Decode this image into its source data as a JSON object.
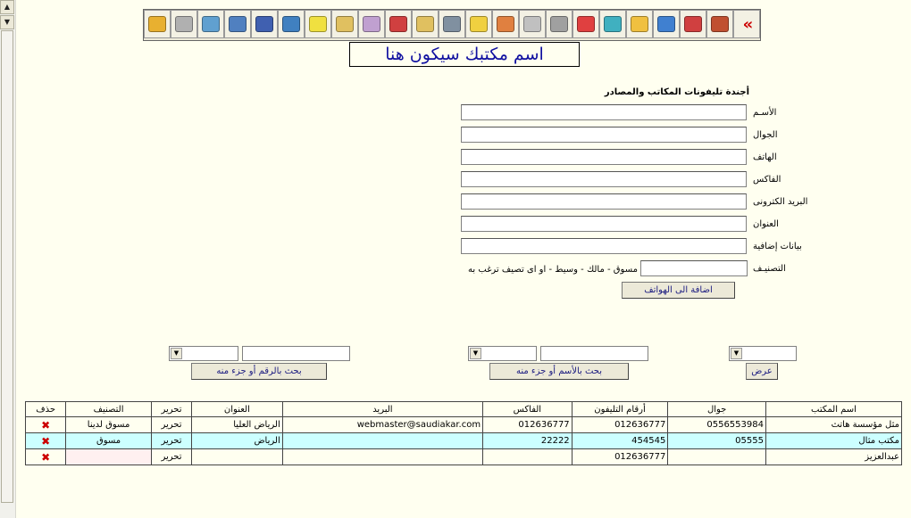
{
  "form": {
    "title": "أجندة تليفونات المكاتب والمصادر",
    "fields": [
      {
        "label": "الأسـم"
      },
      {
        "label": "الجوال"
      },
      {
        "label": "الهاتف"
      },
      {
        "label": "الفاكس"
      },
      {
        "label": "البريد الكترونى"
      },
      {
        "label": "العنوان"
      },
      {
        "label": "بيانات إضافية"
      }
    ],
    "class_label": "التصنيـف",
    "class_hint": "مسوق - مالك - وسيط - او اى تصيف ترغب به",
    "add_button": "اضافة الى الهواتف"
  },
  "header": {
    "office_name": "اسم مكتبك سيكون هنا"
  },
  "toolbar": {
    "icons": [
      "lock-icon",
      "printer-icon",
      "export-icon",
      "globe-icon",
      "save-disk-icon",
      "save-disk-2-icon",
      "notes-icon",
      "rotate-icon",
      "users-icon",
      "edit-icon",
      "clipboard-icon",
      "tools-icon",
      "weather-icon",
      "chart-icon",
      "drive-icon",
      "drive-2-icon",
      "boxes-icon",
      "folder-cyan-icon",
      "folder-yellow-icon",
      "folder-blue-icon",
      "folder-red-icon",
      "home-icon",
      "back-arrows-icon"
    ],
    "colors": [
      "#e8b030",
      "#b0b0b0",
      "#60a0d0",
      "#5080c0",
      "#4060b0",
      "#4080c0",
      "#f0e040",
      "#e0c060",
      "#c0a0d0",
      "#d04040",
      "#e0c060",
      "#8090a0",
      "#f0d040",
      "#e08040",
      "#c0c0c0",
      "#a0a0a0",
      "#e04040",
      "#40b0c0",
      "#f0c040",
      "#4080d0",
      "#d04040",
      "#c05030",
      "#c00000"
    ]
  },
  "search": {
    "view_button": "عرض",
    "by_name_button": "بحث بالأسم أو جزء منه",
    "by_number_button": "بحث بالرقم أو جزء منه"
  },
  "table": {
    "columns": [
      "اسم المكتب",
      "جوال",
      "أرقام التليفون",
      "الفاكس",
      "البريد",
      "العنوان",
      "تحرير",
      "التصنيف",
      "حذف"
    ],
    "rows": [
      {
        "name": "مثل مؤسسة هاتث",
        "mobile": "0556553984",
        "phone": "012636777",
        "fax": "012636777",
        "email": "webmaster@saudiakar.com",
        "address": "الرياض العليا",
        "edit": "تحرير",
        "class": "مسوق لدينا",
        "del": "✖"
      },
      {
        "name": "مكتب مثال",
        "mobile": "05555",
        "phone": "454545",
        "fax": "22222",
        "email": "",
        "address": "الرياض",
        "edit": "تحرير",
        "class": "مسوق",
        "del": "✖"
      },
      {
        "name": "عبدالعزيز",
        "mobile": "",
        "phone": "012636777",
        "fax": "",
        "email": "",
        "address": "",
        "edit": "تحرير",
        "class": "",
        "del": "✖"
      }
    ]
  }
}
